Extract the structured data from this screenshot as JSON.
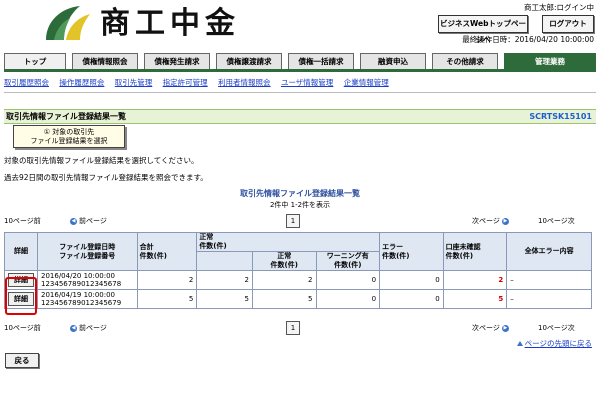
{
  "header": {
    "logo_text": "商工中金",
    "user_status": "商工太郎:ログイン中",
    "bizweb_top_button": "ビジネスWebトップページへ",
    "logout_button": "ログアウト",
    "last_operation": "最終操作日時：2016/04/20 10:00:00",
    "colors": {
      "logo_green": "#2e6b3a",
      "logo_yellow": "#e2c428"
    }
  },
  "tabs": [
    {
      "label": "トップ"
    },
    {
      "label": "債権情報照会"
    },
    {
      "label": "債権発生請求"
    },
    {
      "label": "債権譲渡請求"
    },
    {
      "label": "債権一括請求"
    },
    {
      "label": "融資申込"
    },
    {
      "label": "その他請求"
    },
    {
      "label": "管理業務"
    }
  ],
  "subnav": [
    "取引履歴照会",
    "操作履歴照会",
    "取引先管理",
    "指定許可管理",
    "利用者情報照会",
    "ユーザ情報管理",
    "企業情報管理"
  ],
  "page": {
    "title": "取引先情報ファイル登録結果一覧",
    "screen_id": "SCRTSK15101",
    "step_line1": "① 対象の取引先",
    "step_line2": "ファイル登録結果を選択",
    "msg1": "対象の取引先情報ファイル登録結果を選択してください。",
    "msg2": "過去92日間の取引先情報ファイル登録結果を照会できます。",
    "table_title": "取引先情報ファイル登録結果一覧",
    "count_text": "2件中 1-2件を表示"
  },
  "pager": {
    "prev10": "10ページ前",
    "prev": "前ページ",
    "page_num": "1",
    "next": "次ページ",
    "next10": "10ページ次"
  },
  "table": {
    "headers": {
      "detail": "詳細",
      "file_date": "ファイル登録日時",
      "file_no": "ファイル登録番号",
      "total": "合計",
      "total_unit": "件数(件)",
      "normal": "正常",
      "normal_unit": "件数(件)",
      "normal_sub": "正常",
      "normal_sub_unit": "件数(件)",
      "warning": "ワーニング有",
      "warning_unit": "件数(件)",
      "error": "エラー",
      "error_unit": "件数(件)",
      "unconfirmed": "口座未確認",
      "unconfirmed_unit": "件数(件)",
      "all_errors": "全体エラー内容"
    },
    "rows": [
      {
        "detail_button": "詳細",
        "date": "2016/04/20 10:00:00",
        "file_no": "123456789012345678",
        "total": "2",
        "normal": "2",
        "normal_ok": "2",
        "warning": "0",
        "error": "0",
        "unconfirmed": "2",
        "error_detail": "–"
      },
      {
        "detail_button": "詳細",
        "date": "2016/04/19 10:00:00",
        "file_no": "123456789012345679",
        "total": "5",
        "normal": "5",
        "normal_ok": "5",
        "warning": "0",
        "error": "0",
        "unconfirmed": "5",
        "error_detail": "–"
      }
    ]
  },
  "footer": {
    "back_button": "戻る",
    "to_top_link": "ページの先頭に戻る"
  }
}
